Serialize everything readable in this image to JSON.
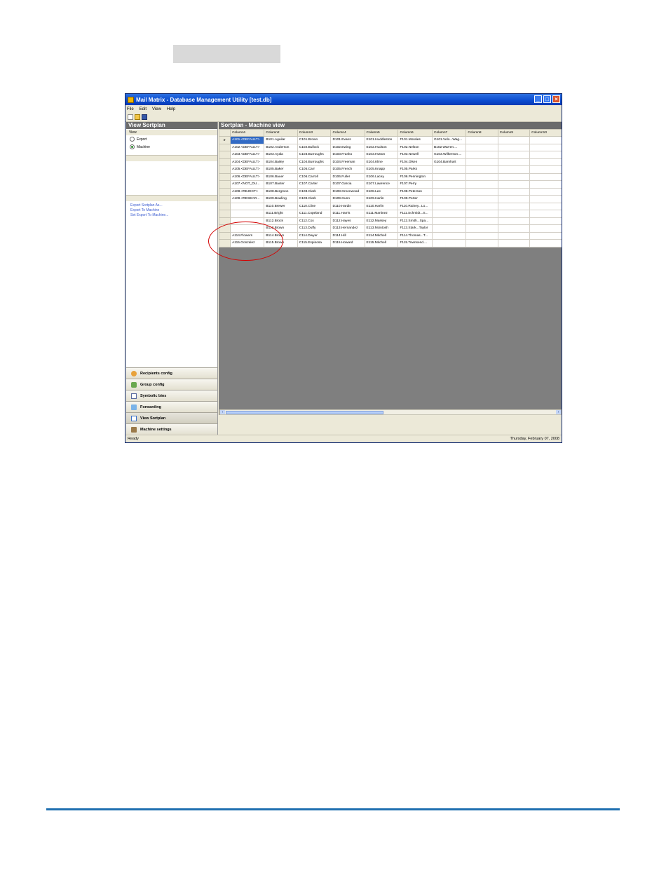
{
  "window": {
    "title": "Mail Matrix - Database Management Utility [test.db]",
    "menu": [
      "File",
      "Edit",
      "View",
      "Help"
    ]
  },
  "left_panel": {
    "title": "View Sortplan",
    "group_label": "View",
    "options": [
      "Export",
      "Machine"
    ],
    "selected": "Machine",
    "links": [
      "Export Sortplan As...",
      "Export To Machine",
      "Set Export To Machine..."
    ]
  },
  "nav": [
    {
      "label": "Recipients config",
      "icon": "person-icon"
    },
    {
      "label": "Group config",
      "icon": "group-icon"
    },
    {
      "label": "Symbolic bins",
      "icon": "bins-icon"
    },
    {
      "label": "Forwarding",
      "icon": "forward-icon"
    },
    {
      "label": "View Sortplan",
      "icon": "sortplan-icon"
    },
    {
      "label": "Machine settings",
      "icon": "settings-icon"
    }
  ],
  "right_panel": {
    "title": "Sortplan - Machine view"
  },
  "grid": {
    "columns": [
      "Column1",
      "Column2",
      "Column3",
      "Column4",
      "Column5",
      "Column6",
      "Column7",
      "Column8",
      "Column9",
      "Column10"
    ],
    "rows": [
      [
        "A101.<DEFAULT>",
        "B101.Aguilar",
        "C101.Brown",
        "D101.Evans",
        "E101.Huddleston",
        "F101.Morales",
        "G101.Velo...Wag...",
        "",
        "",
        ""
      ],
      [
        "A102.<DEFAULT>",
        "B102.Anderson",
        "C102.Bullock",
        "D102.Ewing",
        "E102.Hudson",
        "F102.Nelson",
        "B102.Warren....",
        "",
        "",
        ""
      ],
      [
        "A103.<DEFAULT>",
        "B103.Ayala",
        "C103.Burroughs",
        "D103.Franko",
        "E103.Hutton",
        "F103.Newell",
        "G103.Wilkerson....",
        "",
        "",
        ""
      ],
      [
        "A104.<DEFAULT>",
        "B104.Bailey",
        "C104.Burroughs",
        "D104.Freeman",
        "E104.Kline",
        "F104.Olsen",
        "G104.Barnhart",
        "",
        "",
        ""
      ],
      [
        "A105.<DEFAULT>",
        "B105.Baker",
        "C105.Carr",
        "D105.French",
        "E105.Knapp",
        "F105.Parks",
        "",
        "",
        "",
        ""
      ],
      [
        "A106.<DEFAULT>",
        "B106.Bauer",
        "C106.Carroll",
        "D106.Fuller",
        "E106.Lacey",
        "F106.Pennington",
        "",
        "",
        "",
        ""
      ],
      [
        "A107.<NOT_DU...",
        "B107.Baxter",
        "C107.Carter",
        "D107.Garcia",
        "E107.Lawrence",
        "F107.Perry",
        "",
        "",
        "",
        ""
      ],
      [
        "A108.<REJECT>",
        "B108.Bergmon",
        "C108.Clark",
        "D108.Greenwood",
        "E108.Lee",
        "F108.Peterson",
        "",
        "",
        "",
        ""
      ],
      [
        "A109.<RESEAR...",
        "B109.Bowling",
        "C109.Clark",
        "D109.Gunn",
        "E109.Harlin",
        "F109.Porter",
        "",
        "",
        "",
        ""
      ],
      [
        "",
        "B110.Brewer",
        "C110.Cline",
        "D110.Hardin",
        "E110.Harlin",
        "F110.Rainey...Lo...",
        "",
        "",
        "",
        ""
      ],
      [
        "",
        "B111.Bright",
        "C111.Copeland",
        "D111.Harris",
        "E111.Martinez",
        "F111.Schmidt...S...",
        "",
        "",
        "",
        ""
      ],
      [
        "",
        "B112.Brock",
        "C112.Cox",
        "D112.Hayes",
        "E112.Massey",
        "F112.Smith...Spa...",
        "",
        "",
        "",
        ""
      ],
      [
        "",
        "B113.Brown",
        "C113.Duffy",
        "D113.Hernandez",
        "E113.Mcintosh",
        "F113.Stark...Taylor",
        "",
        "",
        "",
        ""
      ],
      [
        "A114.Flowers",
        "B114.Brown",
        "C114.Dwyer",
        "D114.Hill",
        "E114.Mitchell",
        "F114.Thomas...T...",
        "",
        "",
        "",
        ""
      ],
      [
        "A115.Gonzalez",
        "B115.Brown",
        "C115.Espinosa",
        "D115.Howard",
        "E115.Mitchell",
        "F115.Townsend....",
        "",
        "",
        "",
        ""
      ]
    ]
  },
  "status": {
    "left": "Ready",
    "right": "Thursday, February 07, 2008"
  }
}
